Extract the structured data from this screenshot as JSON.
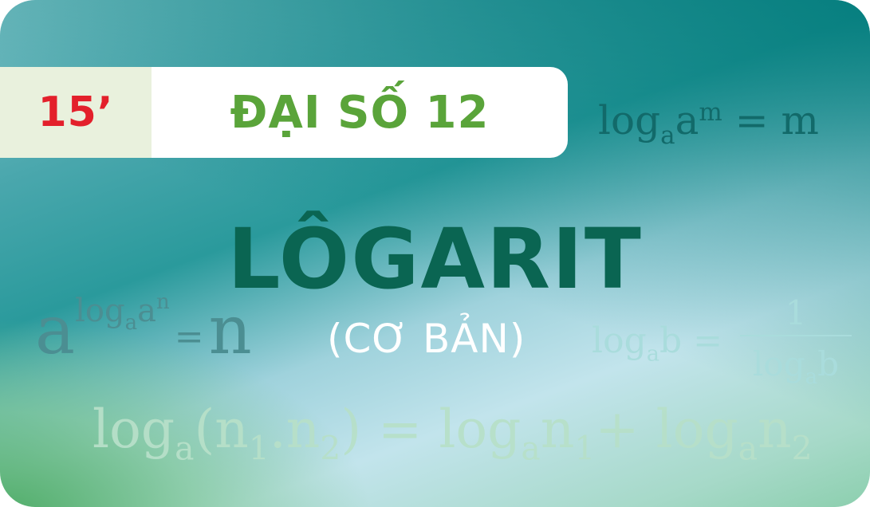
{
  "badge": {
    "text": "15’",
    "color": "#e3202b"
  },
  "header": {
    "subject": "ĐẠI SỐ 12",
    "color": "#5aa43a"
  },
  "title": {
    "text": "LÔGARIT",
    "color": "#0a6552"
  },
  "subtitle": {
    "text": "(CƠ BẢN)"
  },
  "formulas": {
    "f1": {
      "log": "log",
      "base": "a",
      "arg": "a",
      "exp": "m",
      "rhs": "= m"
    },
    "f2": {
      "big": "a",
      "log": "log",
      "base": "a",
      "arg": "a",
      "exp": "n",
      "eq": "=",
      "rhs": "n"
    },
    "f3": {
      "lhs": "log",
      "base": "a",
      "arg": "b =",
      "num": "1",
      "den_log": "log",
      "den_base": "a",
      "den_arg": "b"
    },
    "f4": {
      "log1": "log",
      "base1": "a",
      "open": "(n",
      "s1": "1",
      "dot": ".n",
      "s2": "2",
      "close": ") = ",
      "log2": "log",
      "base2": "a",
      "n1": "n",
      "s3": "1",
      "plus": "+ ",
      "log3": "log",
      "base3": "a",
      "n2": "n",
      "s4": "2"
    }
  },
  "colors": {
    "teal": "#007a7a",
    "green": "#4aaa60",
    "light_blue": "#c2e4ec"
  }
}
